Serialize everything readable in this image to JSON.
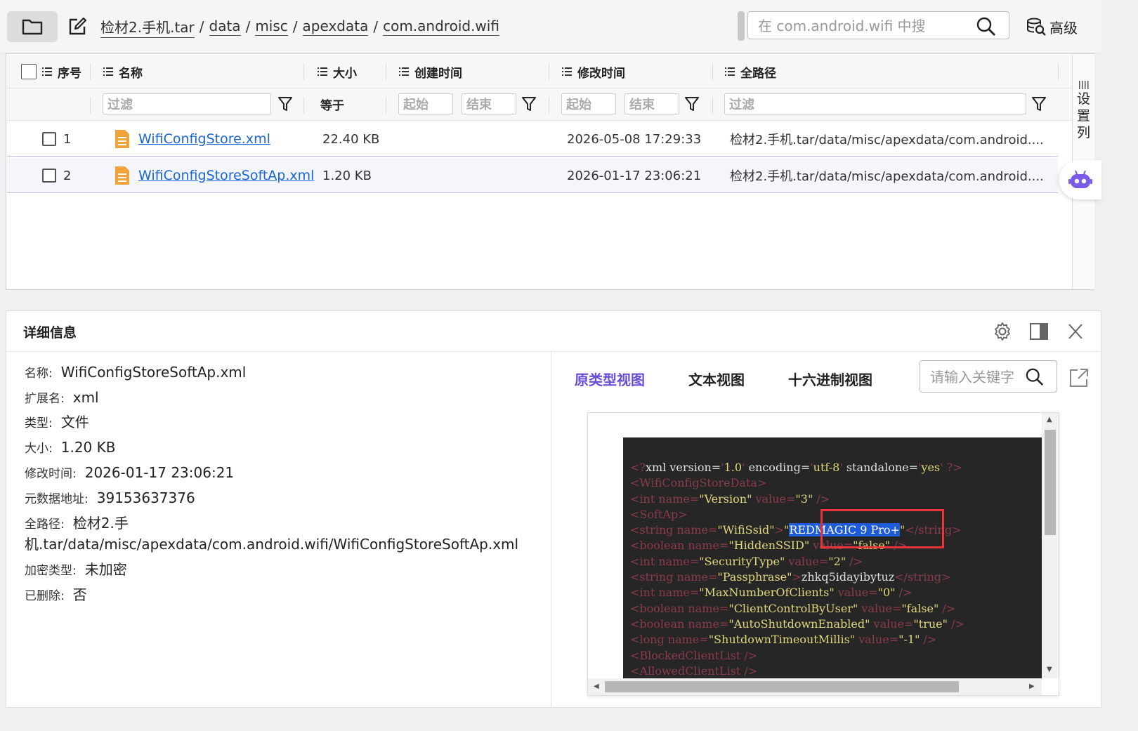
{
  "breadcrumb": [
    "检材2.手机.tar",
    "data",
    "misc",
    "apexdata",
    "com.android.wifi"
  ],
  "search": {
    "placeholder": "在 com.android.wifi 中搜"
  },
  "advanced_label": "高级",
  "table": {
    "columns": [
      "序号",
      "名称",
      "大小",
      "创建时间",
      "修改时间",
      "全路径"
    ],
    "filters": {
      "name_placeholder": "过滤",
      "size_label": "等于",
      "start_placeholder": "起始",
      "end_placeholder": "结束",
      "path_placeholder": "过滤"
    },
    "rows": [
      {
        "index": "1",
        "name": "WifiConfigStore.xml",
        "size": "22.40 KB",
        "created": "",
        "modified": "2026-05-08 17:29:33",
        "path": "检材2.手机.tar/data/misc/apexdata/com.android...."
      },
      {
        "index": "2",
        "name": "WifiConfigStoreSoftAp.xml",
        "size": "1.20 KB",
        "created": "",
        "modified": "2026-01-17 23:06:21",
        "path": "检材2.手机.tar/data/misc/apexdata/com.android...."
      }
    ],
    "settings_label": "设置列"
  },
  "detail": {
    "title": "详细信息",
    "props": [
      {
        "k": "名称:",
        "v": "WifiConfigStoreSoftAp.xml"
      },
      {
        "k": "扩展名:",
        "v": "xml"
      },
      {
        "k": "类型:",
        "v": "文件"
      },
      {
        "k": "大小:",
        "v": "1.20 KB"
      },
      {
        "k": "修改时间:",
        "v": "2026-01-17 23:06:21"
      },
      {
        "k": "元数据地址:",
        "v": "39153637376"
      },
      {
        "k": "全路径:",
        "v": "检材2.手"
      },
      {
        "k": "",
        "v": "机.tar/data/misc/apexdata/com.android.wifi/WifiConfigStoreSoftAp.xml"
      },
      {
        "k": "加密类型:",
        "v": "未加密"
      },
      {
        "k": "已删除:",
        "v": "否"
      }
    ]
  },
  "viewer": {
    "tabs": [
      "原类型视图",
      "文本视图",
      "十六进制视图"
    ],
    "active_tab": 0,
    "search_placeholder": "请输入关键字",
    "highlight": "REDMAGIC 9 Pro+",
    "xml": {
      "decl": {
        "version": "1.0",
        "encoding": "utf-8",
        "standalone": "yes"
      },
      "root": "WifiConfigStoreData",
      "version_value": "3",
      "softap": "SoftAp",
      "ssid_name": "WifiSsid",
      "hidden_name": "HiddenSSID",
      "hidden_value": "false",
      "security_name": "SecurityType",
      "security_value": "2",
      "passphrase_name": "Passphrase",
      "passphrase": "zhkq5idayibytuz",
      "maxclients_name": "MaxNumberOfClients",
      "maxclients_value": "0",
      "clientctrl_name": "ClientControlByUser",
      "clientctrl_value": "false",
      "autoshutdown_name": "AutoShutdownEnabled",
      "autoshutdown_value": "true",
      "timeout_name": "ShutdownTimeoutMillis",
      "timeout_value": "-1",
      "blocked": "BlockedClientList",
      "allowed": "AllowedClientList"
    }
  }
}
